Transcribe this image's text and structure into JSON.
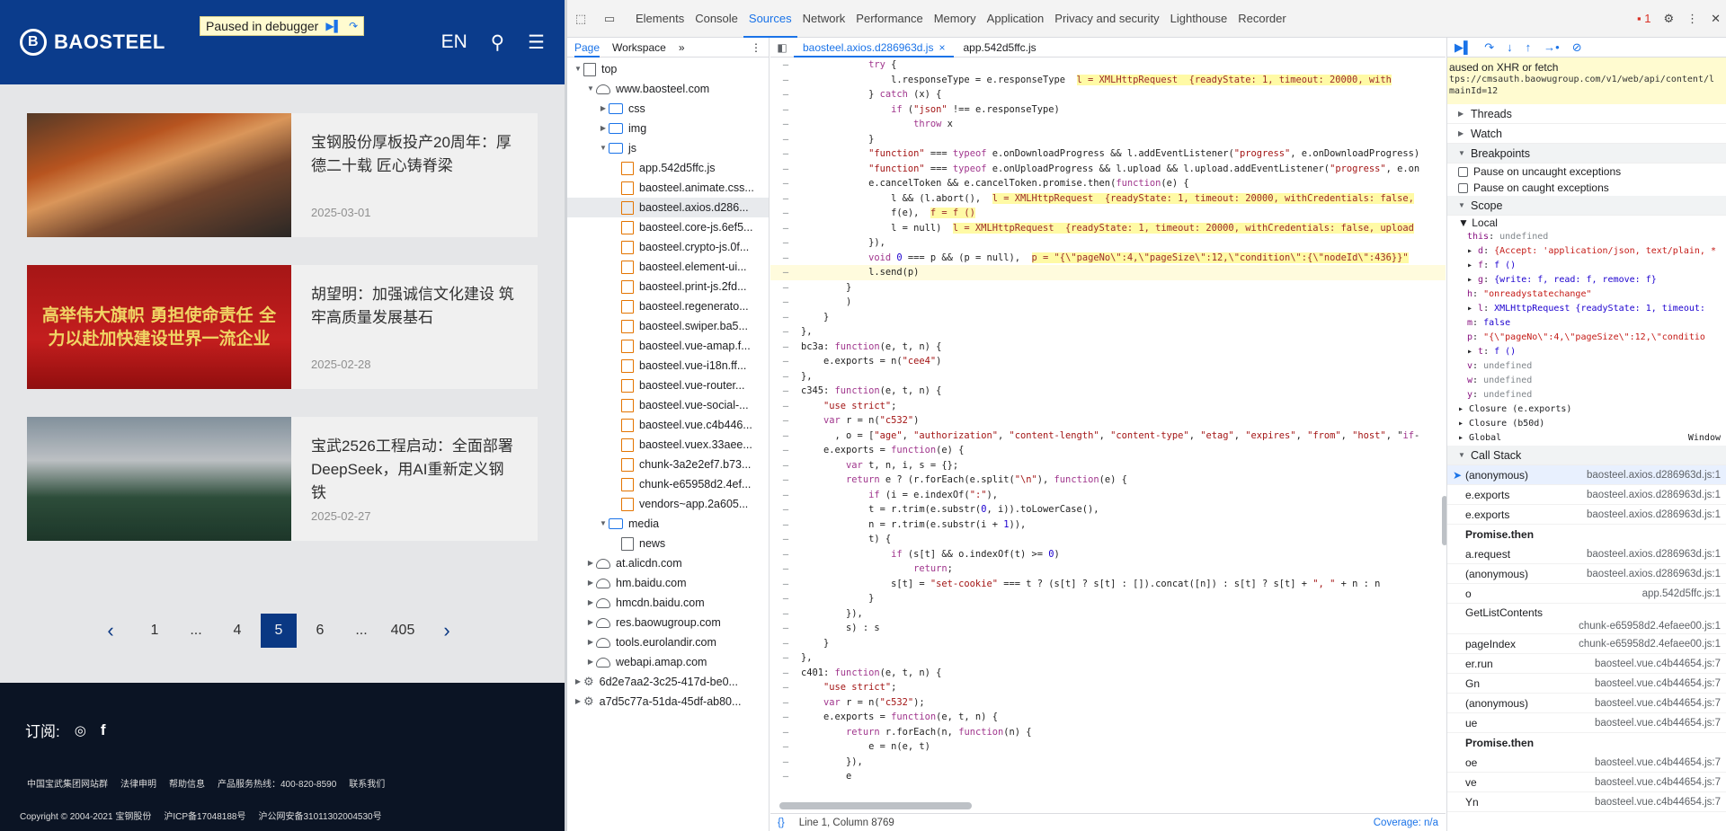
{
  "website": {
    "logo_text": "BAOSTEEL",
    "lang": "EN",
    "debugger_banner": "Paused in debugger",
    "news": [
      {
        "title": "宝钢股份厚板投产20周年：厚德二十载 匠心铸脊梁",
        "date": "2025-03-01",
        "photo_banner": ""
      },
      {
        "title": "胡望明：加强诚信文化建设 筑牢高质量发展基石",
        "date": "2025-02-28",
        "photo_banner": "高举伟大旗帜 勇担使命责任 全力以赴加快建设世界一流企业"
      },
      {
        "title": "宝武2526工程启动：全面部署DeepSeek，用AI重新定义钢铁",
        "date": "2025-02-27",
        "photo_banner": ""
      }
    ],
    "pager": [
      "1",
      "...",
      "4",
      "5",
      "6",
      "...",
      "405"
    ],
    "footer": {
      "subscribe": "订阅:",
      "links": [
        "中国宝武集团网站群",
        "法律申明",
        "帮助信息",
        "产品服务热线：400-820-8590",
        "联系我们"
      ],
      "copyright": [
        "Copyright © 2004-2021 宝钢股份",
        "沪ICP备17048188号",
        "沪公网安备31011302004530号"
      ]
    }
  },
  "devtools": {
    "tabs": [
      "Elements",
      "Console",
      "Sources",
      "Network",
      "Performance",
      "Memory",
      "Application",
      "Privacy and security",
      "Lighthouse",
      "Recorder"
    ],
    "issues_count": "1",
    "navigator_tabs": [
      "Page",
      "Workspace"
    ],
    "tree": [
      {
        "label": "top",
        "type": "frame",
        "level": 0,
        "open": true
      },
      {
        "label": "www.baosteel.com",
        "type": "cloud",
        "level": 1,
        "open": true
      },
      {
        "label": "css",
        "type": "folder",
        "level": 2,
        "open": false
      },
      {
        "label": "img",
        "type": "folder",
        "level": 2,
        "open": false
      },
      {
        "label": "js",
        "type": "folder",
        "level": 2,
        "open": true
      },
      {
        "label": "app.542d5ffc.js",
        "type": "file",
        "level": 3
      },
      {
        "label": "baosteel.animate.css...",
        "type": "file",
        "level": 3
      },
      {
        "label": "baosteel.axios.d286...",
        "type": "file",
        "level": 3,
        "selected": true
      },
      {
        "label": "baosteel.core-js.6ef5...",
        "type": "file",
        "level": 3
      },
      {
        "label": "baosteel.crypto-js.0f...",
        "type": "file",
        "level": 3
      },
      {
        "label": "baosteel.element-ui...",
        "type": "file",
        "level": 3
      },
      {
        "label": "baosteel.print-js.2fd...",
        "type": "file",
        "level": 3
      },
      {
        "label": "baosteel.regenerato...",
        "type": "file",
        "level": 3
      },
      {
        "label": "baosteel.swiper.ba5...",
        "type": "file",
        "level": 3
      },
      {
        "label": "baosteel.vue-amap.f...",
        "type": "file",
        "level": 3
      },
      {
        "label": "baosteel.vue-i18n.ff...",
        "type": "file",
        "level": 3
      },
      {
        "label": "baosteel.vue-router...",
        "type": "file",
        "level": 3
      },
      {
        "label": "baosteel.vue-social-...",
        "type": "file",
        "level": 3
      },
      {
        "label": "baosteel.vue.c4b446...",
        "type": "file",
        "level": 3
      },
      {
        "label": "baosteel.vuex.33aee...",
        "type": "file",
        "level": 3
      },
      {
        "label": "chunk-3a2e2ef7.b73...",
        "type": "file",
        "level": 3
      },
      {
        "label": "chunk-e65958d2.4ef...",
        "type": "file",
        "level": 3
      },
      {
        "label": "vendors~app.2a605...",
        "type": "file",
        "level": 3
      },
      {
        "label": "media",
        "type": "folder",
        "level": 2,
        "open": true
      },
      {
        "label": "news",
        "type": "wfile",
        "level": 3
      },
      {
        "label": "at.alicdn.com",
        "type": "cloud",
        "level": 1,
        "open": false
      },
      {
        "label": "hm.baidu.com",
        "type": "cloud",
        "level": 1,
        "open": false
      },
      {
        "label": "hmcdn.baidu.com",
        "type": "cloud",
        "level": 1,
        "open": false
      },
      {
        "label": "res.baowugroup.com",
        "type": "cloud",
        "level": 1,
        "open": false
      },
      {
        "label": "tools.eurolandir.com",
        "type": "cloud",
        "level": 1,
        "open": false
      },
      {
        "label": "webapi.amap.com",
        "type": "cloud",
        "level": 1,
        "open": false
      },
      {
        "label": "6d2e7aa2-3c25-417d-be0...",
        "type": "gear",
        "level": 0,
        "open": false
      },
      {
        "label": "a7d5c77a-51da-45df-ab80...",
        "type": "gear",
        "level": 0,
        "open": false
      }
    ],
    "editor_tabs": [
      "baosteel.axios.d286963d.js",
      "app.542d5ffc.js"
    ],
    "code": [
      {
        "t": "            try {"
      },
      {
        "t": "                l.responseType = e.responseType  ",
        "e": "l = XMLHttpRequest  {readyState: 1, timeout: 20000, with"
      },
      {
        "t": "            } catch (x) {"
      },
      {
        "t": "                if (\"json\" !== e.responseType)"
      },
      {
        "t": "                    throw x"
      },
      {
        "t": "            }"
      },
      {
        "t": "            \"function\" === typeof e.onDownloadProgress && l.addEventListener(\"progress\", e.onDownloadProgress)"
      },
      {
        "t": "            \"function\" === typeof e.onUploadProgress && l.upload && l.upload.addEventListener(\"progress\", e.on"
      },
      {
        "t": "            e.cancelToken && e.cancelToken.promise.then(function(e) {"
      },
      {
        "t": "                l && (l.abort(),  ",
        "e": "l = XMLHttpRequest  {readyState: 1, timeout: 20000, withCredentials: false,"
      },
      {
        "t": "                f(e),  ",
        "e": "f = f ()"
      },
      {
        "t": "                l = null)  ",
        "e": "l = XMLHttpRequest  {readyState: 1, timeout: 20000, withCredentials: false, upload"
      },
      {
        "t": "            }),"
      },
      {
        "t": "            void 0 === p && (p = null),  ",
        "e": "p = \"{\\\"pageNo\\\":4,\\\"pageSize\\\":12,\\\"condition\\\":{\\\"nodeId\\\":436}}\""
      },
      {
        "t": "            l.send(p)",
        "hl": true
      },
      {
        "t": "        }"
      },
      {
        "t": "        )"
      },
      {
        "t": "    }"
      },
      {
        "t": "},"
      },
      {
        "t": "bc3a: function(e, t, n) {"
      },
      {
        "t": "    e.exports = n(\"cee4\")"
      },
      {
        "t": "},"
      },
      {
        "t": "c345: function(e, t, n) {"
      },
      {
        "t": "    \"use strict\";"
      },
      {
        "t": "    var r = n(\"c532\")"
      },
      {
        "t": "      , o = [\"age\", \"authorization\", \"content-length\", \"content-type\", \"etag\", \"expires\", \"from\", \"host\", \"if-"
      },
      {
        "t": "    e.exports = function(e) {"
      },
      {
        "t": "        var t, n, i, s = {};"
      },
      {
        "t": "        return e ? (r.forEach(e.split(\"\\n\"), function(e) {"
      },
      {
        "t": "            if (i = e.indexOf(\":\"),"
      },
      {
        "t": "            t = r.trim(e.substr(0, i)).toLowerCase(),"
      },
      {
        "t": "            n = r.trim(e.substr(i + 1)),"
      },
      {
        "t": "            t) {"
      },
      {
        "t": "                if (s[t] && o.indexOf(t) >= 0)"
      },
      {
        "t": "                    return;"
      },
      {
        "t": "                s[t] = \"set-cookie\" === t ? (s[t] ? s[t] : []).concat([n]) : s[t] ? s[t] + \", \" + n : n"
      },
      {
        "t": "            }"
      },
      {
        "t": "        }),"
      },
      {
        "t": "        s) : s"
      },
      {
        "t": "    }"
      },
      {
        "t": "},"
      },
      {
        "t": "c401: function(e, t, n) {"
      },
      {
        "t": "    \"use strict\";"
      },
      {
        "t": "    var r = n(\"c532\");"
      },
      {
        "t": "    e.exports = function(e, t, n) {"
      },
      {
        "t": "        return r.forEach(n, function(n) {"
      },
      {
        "t": "            e = n(e, t)"
      },
      {
        "t": "        }),"
      },
      {
        "t": "        e"
      }
    ],
    "status_position": "Line 1, Column 8769",
    "coverage": "Coverage: n/a",
    "pause_reason": "aused on XHR or fetch",
    "pause_url": "tps://cmsauth.baowugroup.com/v1/web/api/content/l",
    "pause_url2": "mainId=12",
    "sections": {
      "threads": "Threads",
      "watch": "Watch",
      "breakpoints": "Breakpoints",
      "scope": "Scope",
      "local": "Local",
      "callstack": "Call Stack"
    },
    "checkboxes": [
      "Pause on uncaught exceptions",
      "Pause on caught exceptions"
    ],
    "scope_vars": [
      {
        "k": "this",
        "v": "undefined",
        "c": "u"
      },
      {
        "k": "d",
        "v": "{Accept: 'application/json, text/plain, *",
        "c": "s",
        "x": true
      },
      {
        "k": "f",
        "v": "f ()",
        "c": "v",
        "x": true
      },
      {
        "k": "g",
        "v": "{write: f, read: f, remove: f}",
        "c": "v",
        "x": true
      },
      {
        "k": "h",
        "v": "\"onreadystatechange\"",
        "c": "s"
      },
      {
        "k": "l",
        "v": "XMLHttpRequest  {readyState: 1, timeout:",
        "c": "v",
        "x": true
      },
      {
        "k": "m",
        "v": "false",
        "c": "v"
      },
      {
        "k": "p",
        "v": "\"{\\\"pageNo\\\":4,\\\"pageSize\\\":12,\\\"conditio",
        "c": "s"
      },
      {
        "k": "t",
        "v": "f ()",
        "c": "v",
        "x": true
      },
      {
        "k": "v",
        "v": "undefined",
        "c": "u"
      },
      {
        "k": "w",
        "v": "undefined",
        "c": "u"
      },
      {
        "k": "y",
        "v": "undefined",
        "c": "u"
      }
    ],
    "closures": [
      "Closure (e.exports)",
      "Closure (b50d)"
    ],
    "global": "Global",
    "global_val": "Window",
    "call_stack": [
      {
        "fn": "(anonymous)",
        "loc": "baosteel.axios.d286963d.js:1",
        "cur": true
      },
      {
        "fn": "e.exports",
        "loc": "baosteel.axios.d286963d.js:1"
      },
      {
        "fn": "e.exports",
        "loc": "baosteel.axios.d286963d.js:1"
      },
      {
        "fn": "Promise.then",
        "loc": "",
        "async": true
      },
      {
        "fn": "a.request",
        "loc": "baosteel.axios.d286963d.js:1"
      },
      {
        "fn": "(anonymous)",
        "loc": "baosteel.axios.d286963d.js:1"
      },
      {
        "fn": "o",
        "loc": "app.542d5ffc.js:1"
      },
      {
        "fn": "GetListContents",
        "loc": "chunk-e65958d2.4efaee00.js:1",
        "two": true
      },
      {
        "fn": "pageIndex",
        "loc": "chunk-e65958d2.4efaee00.js:1"
      },
      {
        "fn": "er.run",
        "loc": "baosteel.vue.c4b44654.js:7"
      },
      {
        "fn": "Gn",
        "loc": "baosteel.vue.c4b44654.js:7"
      },
      {
        "fn": "(anonymous)",
        "loc": "baosteel.vue.c4b44654.js:7"
      },
      {
        "fn": "ue",
        "loc": "baosteel.vue.c4b44654.js:7"
      },
      {
        "fn": "Promise.then",
        "loc": "",
        "async": true
      },
      {
        "fn": "oe",
        "loc": "baosteel.vue.c4b44654.js:7"
      },
      {
        "fn": "ve",
        "loc": "baosteel.vue.c4b44654.js:7"
      },
      {
        "fn": "Yn",
        "loc": "baosteel.vue.c4b44654.js:7"
      }
    ]
  }
}
